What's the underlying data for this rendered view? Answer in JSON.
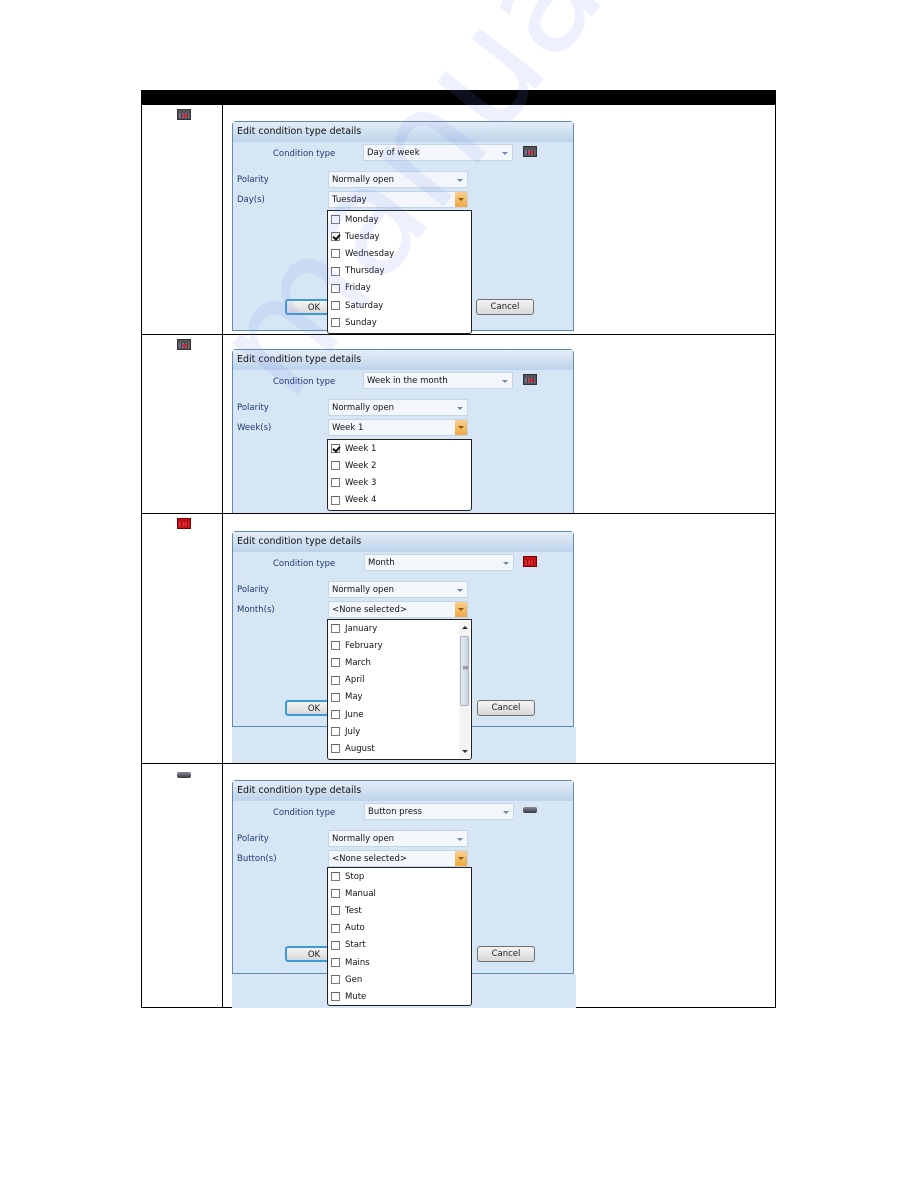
{
  "watermark": "manualshive",
  "rows": [
    {
      "icon": "calendar-icon",
      "dialog": {
        "title": "Edit condition type details",
        "condition_type_label": "Condition type",
        "condition_type_value": "Day of week",
        "polarity_label": "Polarity",
        "polarity_value": "Normally open",
        "field_label": "Day(s)",
        "field_value": "Tuesday",
        "ok_label": "OK",
        "cancel_label": "Cancel",
        "options": [
          {
            "label": "Monday",
            "checked": false
          },
          {
            "label": "Tuesday",
            "checked": true
          },
          {
            "label": "Wednesday",
            "checked": false
          },
          {
            "label": "Thursday",
            "checked": false
          },
          {
            "label": "Friday",
            "checked": false
          },
          {
            "label": "Saturday",
            "checked": false
          },
          {
            "label": "Sunday",
            "checked": false
          }
        ]
      }
    },
    {
      "icon": "calendar-icon",
      "dialog": {
        "title": "Edit condition type details",
        "condition_type_label": "Condition type",
        "condition_type_value": "Week in the month",
        "polarity_label": "Polarity",
        "polarity_value": "Normally open",
        "field_label": "Week(s)",
        "field_value": "Week 1",
        "options": [
          {
            "label": "Week 1",
            "checked": true
          },
          {
            "label": "Week 2",
            "checked": false
          },
          {
            "label": "Week 3",
            "checked": false
          },
          {
            "label": "Week 4",
            "checked": false
          }
        ]
      }
    },
    {
      "icon": "calendar-red-icon",
      "dialog": {
        "title": "Edit condition type details",
        "condition_type_label": "Condition type",
        "condition_type_value": "Month",
        "polarity_label": "Polarity",
        "polarity_value": "Normally open",
        "field_label": "Month(s)",
        "field_value": "<None selected>",
        "ok_label": "OK",
        "cancel_label": "Cancel",
        "options": [
          {
            "label": "January",
            "checked": false
          },
          {
            "label": "February",
            "checked": false
          },
          {
            "label": "March",
            "checked": false
          },
          {
            "label": "April",
            "checked": false
          },
          {
            "label": "May",
            "checked": false
          },
          {
            "label": "June",
            "checked": false
          },
          {
            "label": "July",
            "checked": false
          },
          {
            "label": "August",
            "checked": false
          }
        ]
      }
    },
    {
      "icon": "button-icon",
      "dialog": {
        "title": "Edit condition type details",
        "condition_type_label": "Condition type",
        "condition_type_value": "Button press",
        "polarity_label": "Polarity",
        "polarity_value": "Normally open",
        "field_label": "Button(s)",
        "field_value": "<None selected>",
        "ok_label": "OK",
        "cancel_label": "Cancel",
        "options": [
          {
            "label": "Stop",
            "checked": false
          },
          {
            "label": "Manual",
            "checked": false
          },
          {
            "label": "Test",
            "checked": false
          },
          {
            "label": "Auto",
            "checked": false
          },
          {
            "label": "Start",
            "checked": false
          },
          {
            "label": "Mains",
            "checked": false
          },
          {
            "label": "Gen",
            "checked": false
          },
          {
            "label": "Mute",
            "checked": false
          }
        ]
      }
    }
  ]
}
